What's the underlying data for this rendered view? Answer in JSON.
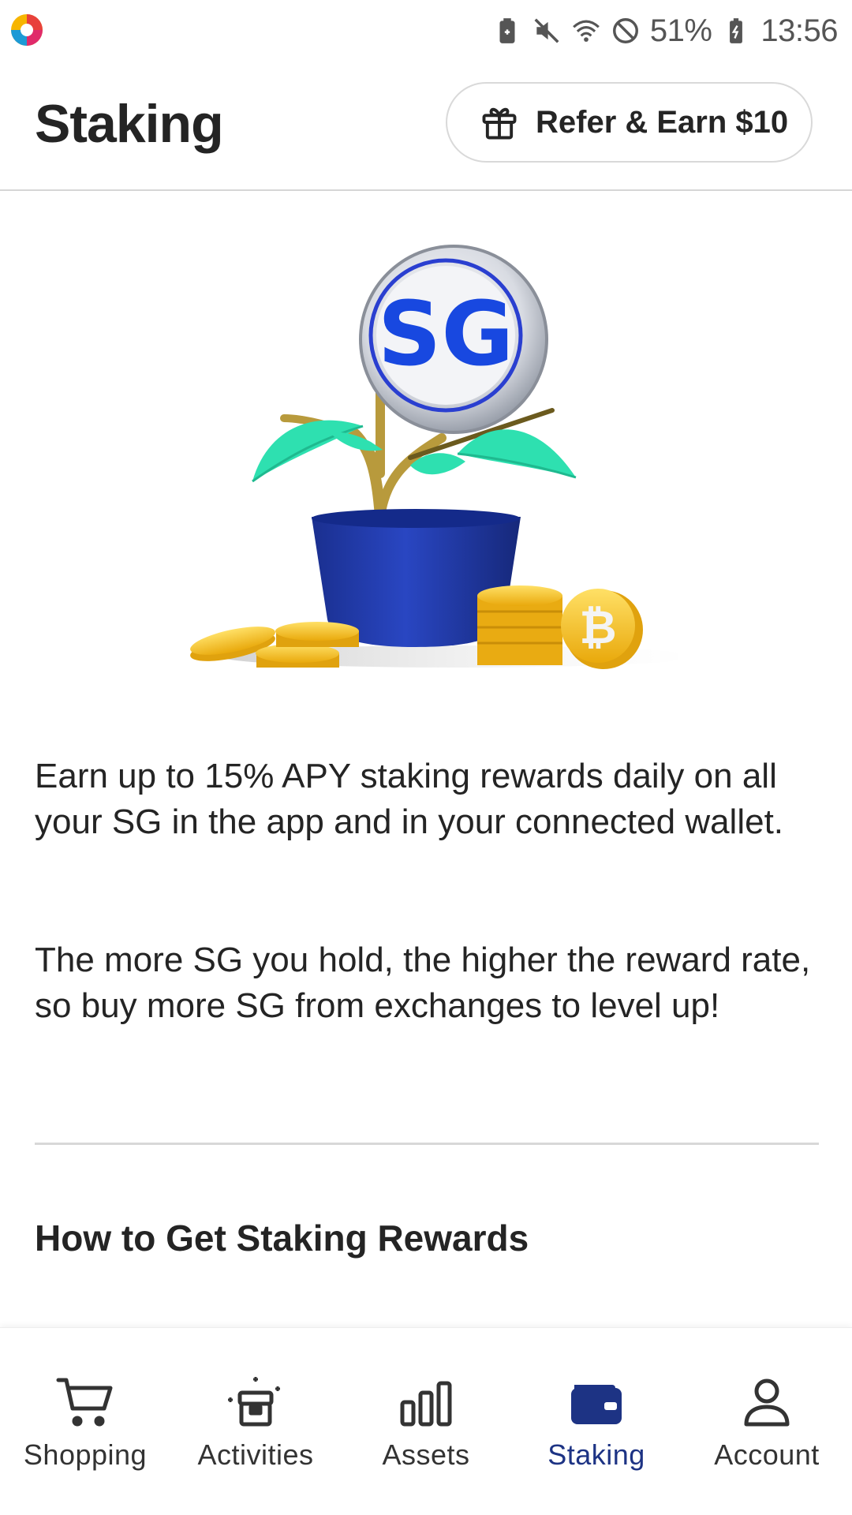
{
  "status_bar": {
    "battery": "51%",
    "time": "13:56",
    "icons": [
      "app-logo-icon",
      "battery-saver-icon",
      "mute-icon",
      "wifi-icon",
      "do-not-disturb-icon",
      "battery-charging-icon"
    ]
  },
  "header": {
    "title": "Staking",
    "refer_button": "Refer & Earn $10",
    "refer_icon": "gift-icon"
  },
  "hero": {
    "illustration": "plant-pot-with-coins-illustration",
    "coin_mark": "SG"
  },
  "content": {
    "paragraph1": "Earn up to 15% APY staking rewards daily on all your SG in the app and in your connected wallet.",
    "paragraph2": "The more SG you hold, the higher the reward rate, so buy more SG from exchanges to level up!",
    "section_title": "How to Get Staking Rewards"
  },
  "nav": {
    "items": [
      {
        "label": "Shopping",
        "icon": "cart-icon",
        "active": false
      },
      {
        "label": "Activities",
        "icon": "gift-box-icon",
        "active": false
      },
      {
        "label": "Assets",
        "icon": "bar-chart-icon",
        "active": false
      },
      {
        "label": "Staking",
        "icon": "wallet-icon",
        "active": true
      },
      {
        "label": "Account",
        "icon": "person-icon",
        "active": false
      }
    ]
  },
  "colors": {
    "accent": "#1d3384",
    "text": "#242424",
    "divider": "#d8d8d8",
    "leaf": "#2ee0b0",
    "pot": "#1f3aa8",
    "coin": "#f6c425"
  }
}
